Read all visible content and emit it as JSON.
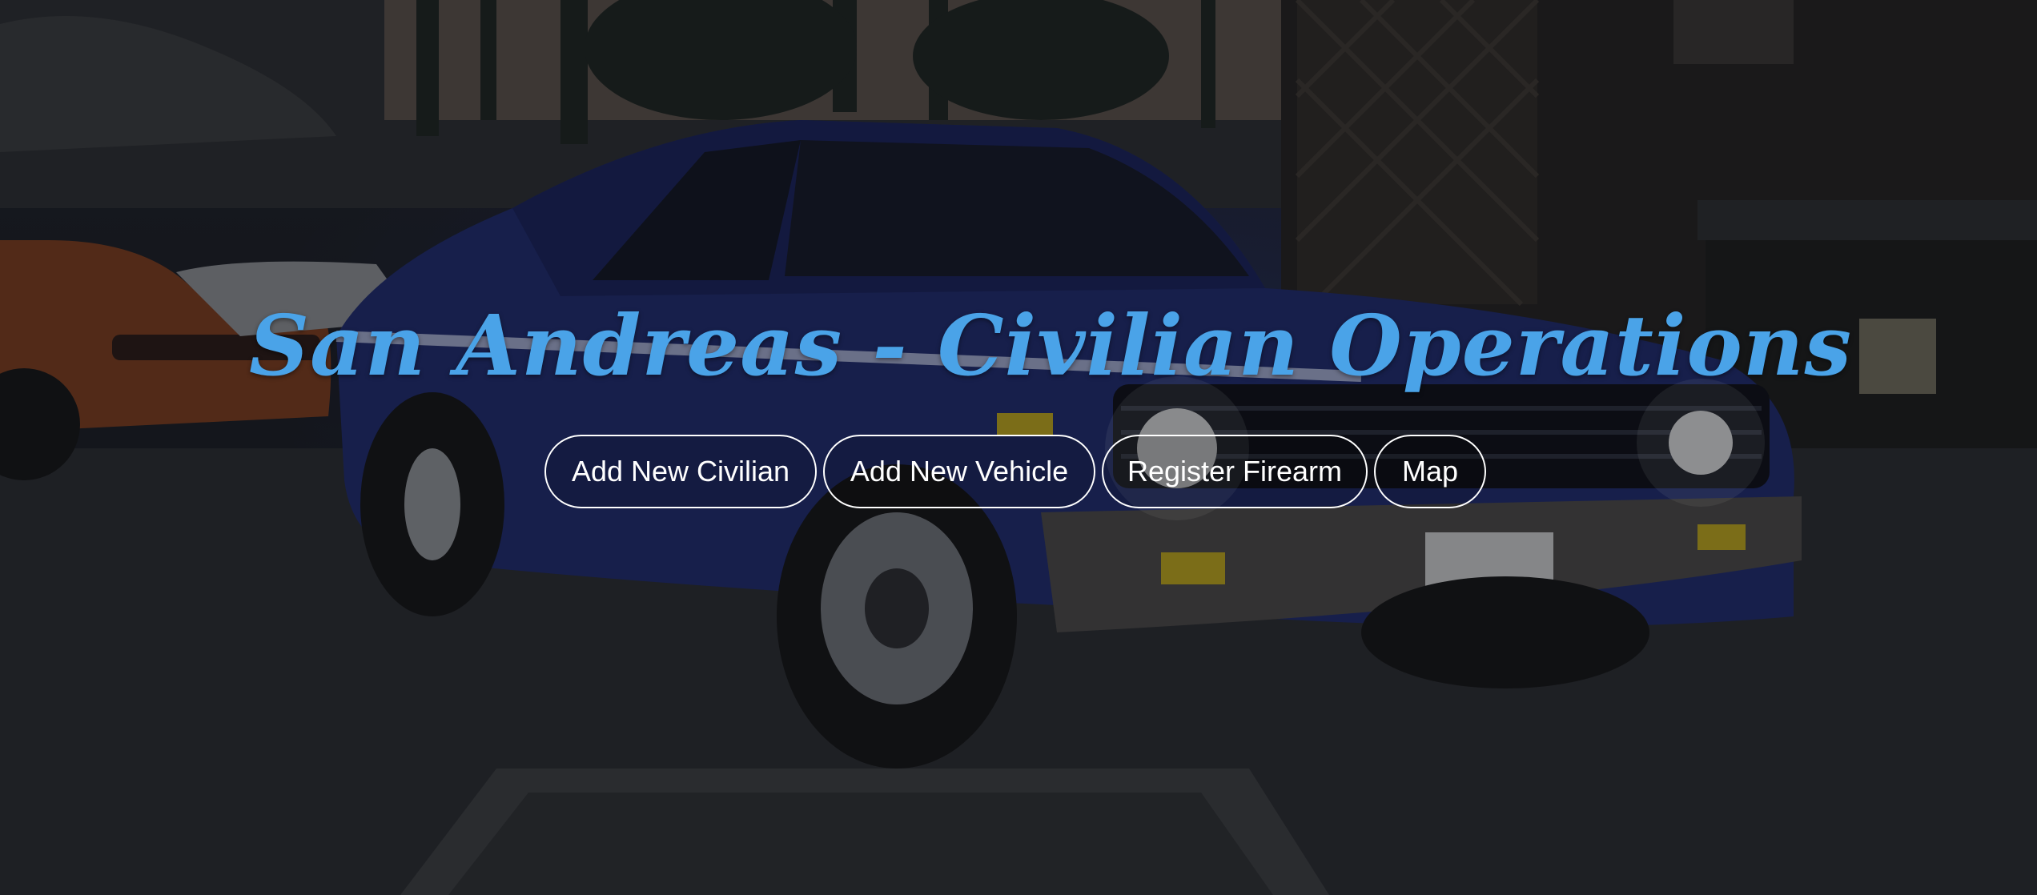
{
  "hero": {
    "title": "San Andreas - Civilian Operations",
    "title_color": "#4aa3e8",
    "background_image": "blue-classic-car-night-scene"
  },
  "nav": {
    "items": [
      {
        "label": "Add New Civilian"
      },
      {
        "label": "Add New Vehicle"
      },
      {
        "label": "Register Firearm"
      },
      {
        "label": "Map"
      }
    ],
    "button_border_color": "#ffffff",
    "button_text_color": "#ffffff"
  }
}
